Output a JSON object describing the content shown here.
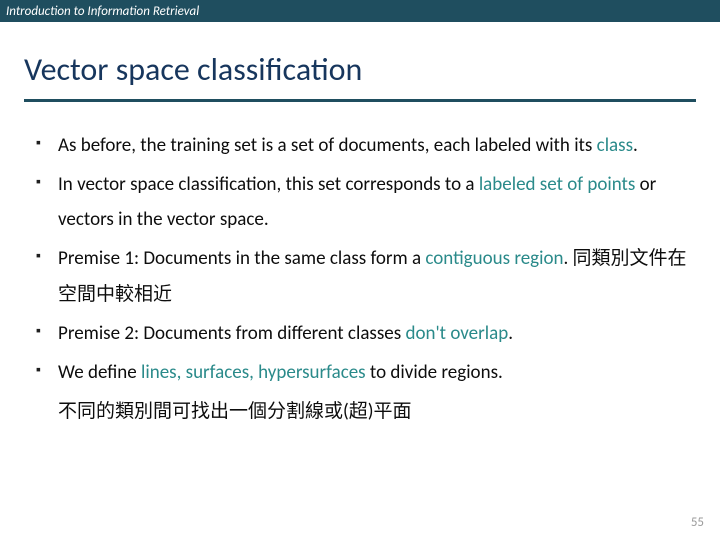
{
  "header": {
    "course": "Introduction to Information Retrieval"
  },
  "title": "Vector space classification",
  "bullets": [
    {
      "pre": "As before, the training set is a set of documents, each labeled with its ",
      "em": "class",
      "post": "."
    },
    {
      "pre": "In vector space classification, this set corresponds to a ",
      "em": "labeled set of points",
      "post": " or vectors in the vector space."
    },
    {
      "pre": "Premise 1: Documents in the same class form a ",
      "em": "contiguous region",
      "post": ".  同類別文件在空間中較相近"
    },
    {
      "pre": "Premise 2: Documents from different classes ",
      "em": "don't overlap",
      "post": "."
    },
    {
      "pre": "We define ",
      "em": "lines, surfaces, hypersurfaces",
      "post": " to divide regions."
    }
  ],
  "trailing": "不同的類別間可找出一個分割線或(超)平面",
  "page_number": "55"
}
